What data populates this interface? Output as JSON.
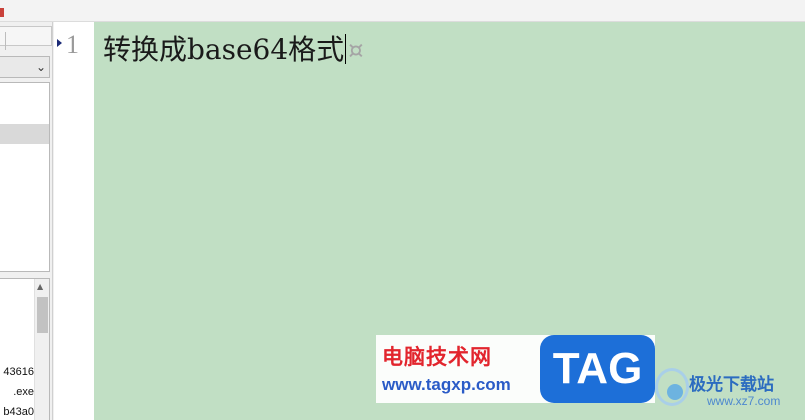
{
  "file_list": {
    "rows": [
      "43616",
      ".exe",
      "b43a0"
    ]
  },
  "editor": {
    "line_number": "1",
    "line_text": "转换成base64格式",
    "end_of_line_glyph": "¤"
  },
  "watermark": {
    "site_name": "电脑技术网",
    "site_url": "www.tagxp.com",
    "tag_text": "TAG",
    "tag_color": "#1d6fd8",
    "secondary_name": "极光下载站",
    "secondary_url": "www.xz7.com"
  },
  "colors": {
    "editor_background": "#c1dfc4",
    "line_number": "#9a9a9a",
    "fold_marker": "#1b2a77"
  }
}
